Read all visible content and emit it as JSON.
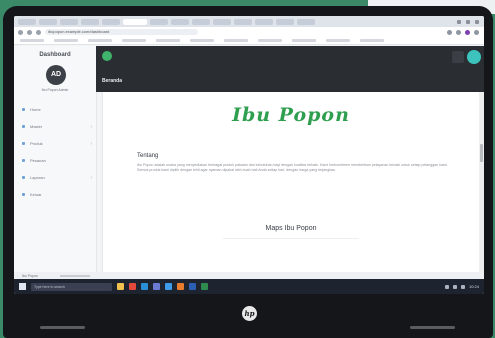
{
  "browser": {
    "url": "ibupopon.example.com/dashboard"
  },
  "sidebar": {
    "brand": "Dashboard",
    "avatar_initials": "AD",
    "user_name": "Ibu Popon Admin",
    "items": [
      {
        "label": "Home",
        "icon": "home-icon",
        "has_submenu": false
      },
      {
        "label": "Master",
        "icon": "database-icon",
        "has_submenu": true
      },
      {
        "label": "Produk",
        "icon": "box-icon",
        "has_submenu": true
      },
      {
        "label": "Pesanan",
        "icon": "cart-icon",
        "has_submenu": false
      },
      {
        "label": "Laporan",
        "icon": "report-icon",
        "has_submenu": true
      },
      {
        "label": "Keluar",
        "icon": "logout-icon",
        "has_submenu": false
      }
    ]
  },
  "header": {
    "title": "Beranda"
  },
  "content": {
    "shop_logo": "Ibu Popon",
    "about_title": "Tentang",
    "about_text": "Ibu Popon adalah usaha yang menyediakan berbagai produk pakaian dan kebutuhan bayi dengan kualitas terbaik. Kami berkomitmen memberikan pelayanan terbaik untuk setiap pelanggan kami. Semua produk kami dipilih dengan teliti agar nyaman dipakai oleh buah hati Anda setiap hari, dengan harga yang terjangkau.",
    "map_title": "Maps Ibu Popon"
  },
  "status_bar": {
    "left": "Ibu Popon"
  },
  "taskbar": {
    "search_placeholder": "Type here to search",
    "time": "10:24",
    "icons": [
      {
        "name": "file-explorer-icon",
        "color": "#f2c14e"
      },
      {
        "name": "chrome-icon",
        "color": "#e4493b"
      },
      {
        "name": "edge-icon",
        "color": "#2a8fd6"
      },
      {
        "name": "store-icon",
        "color": "#6a7bd1"
      },
      {
        "name": "mail-icon",
        "color": "#3d9be9"
      },
      {
        "name": "photos-icon",
        "color": "#e97c2d"
      },
      {
        "name": "word-icon",
        "color": "#2b5fb4"
      },
      {
        "name": "excel-icon",
        "color": "#2e8b4d"
      }
    ]
  },
  "colors": {
    "brand_green": "#2e9e4f",
    "header_dark": "#2a2d31",
    "accent_teal": "#3cc3bd"
  }
}
